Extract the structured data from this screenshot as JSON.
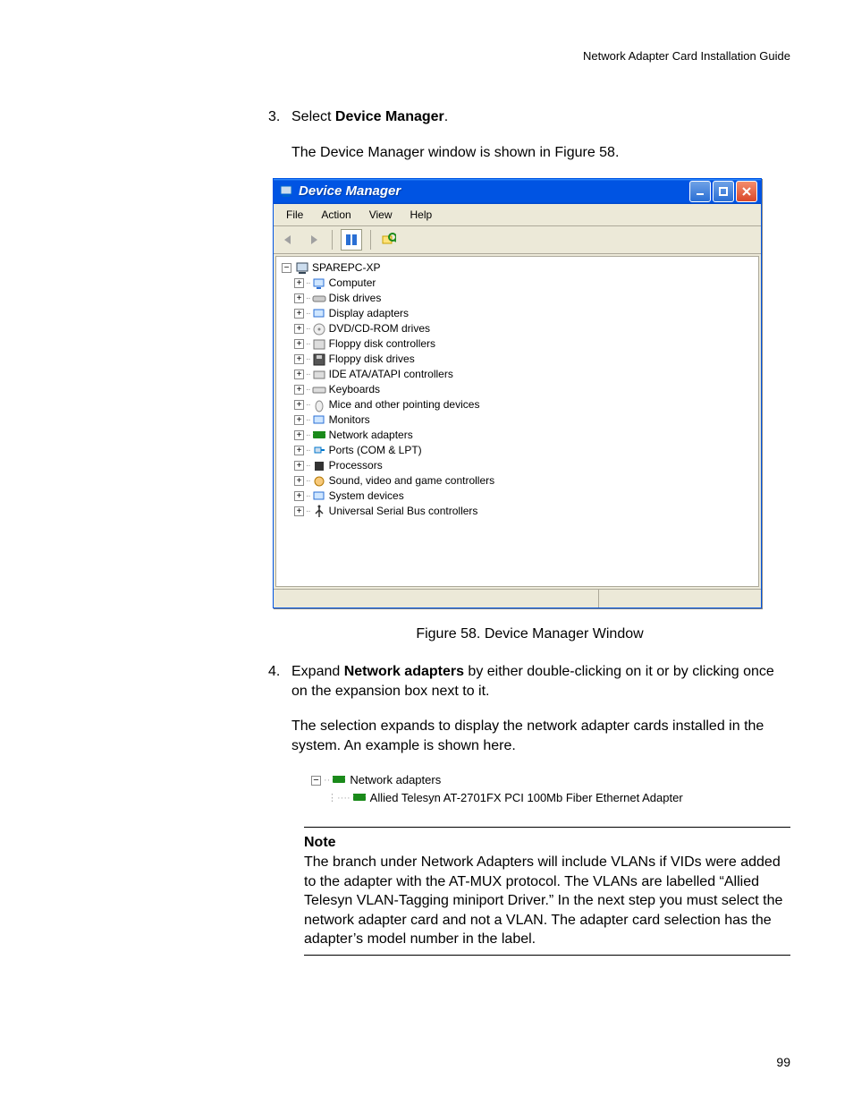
{
  "header": "Network Adapter Card Installation Guide",
  "page_number": "99",
  "step3": {
    "num": "3.",
    "text_prefix": "Select ",
    "text_bold": "Device Manager",
    "text_suffix": ".",
    "after": "The Device Manager window is shown in Figure 58."
  },
  "figure_caption": "Figure 58. Device Manager Window",
  "step4": {
    "num": "4.",
    "text_prefix": "Expand ",
    "text_bold": "Network adapters",
    "text_suffix": " by either double-clicking on it or by clicking once on the expansion box next to it.",
    "after": "The selection expands to display the network adapter cards installed in the system. An example is shown here."
  },
  "snippet": {
    "root": "Network adapters",
    "child": "Allied Telesyn AT-2701FX PCI 100Mb Fiber Ethernet Adapter"
  },
  "note": {
    "title": "Note",
    "body": "The branch under Network Adapters will include VLANs if VIDs were added to the adapter with the AT-MUX protocol. The VLANs are labelled “Allied Telesyn VLAN-Tagging miniport Driver.” In the next step you must select the network adapter card and not a VLAN. The adapter card selection has the adapter’s model number in the label."
  },
  "window": {
    "title": "Device Manager",
    "menus": [
      "File",
      "Action",
      "View",
      "Help"
    ],
    "tree_root": "SPAREPC-XP",
    "tree_items": [
      "Computer",
      "Disk drives",
      "Display adapters",
      "DVD/CD-ROM drives",
      "Floppy disk controllers",
      "Floppy disk drives",
      "IDE ATA/ATAPI controllers",
      "Keyboards",
      "Mice and other pointing devices",
      "Monitors",
      "Network adapters",
      "Ports (COM & LPT)",
      "Processors",
      "Sound, video and game controllers",
      "System devices",
      "Universal Serial Bus controllers"
    ]
  }
}
